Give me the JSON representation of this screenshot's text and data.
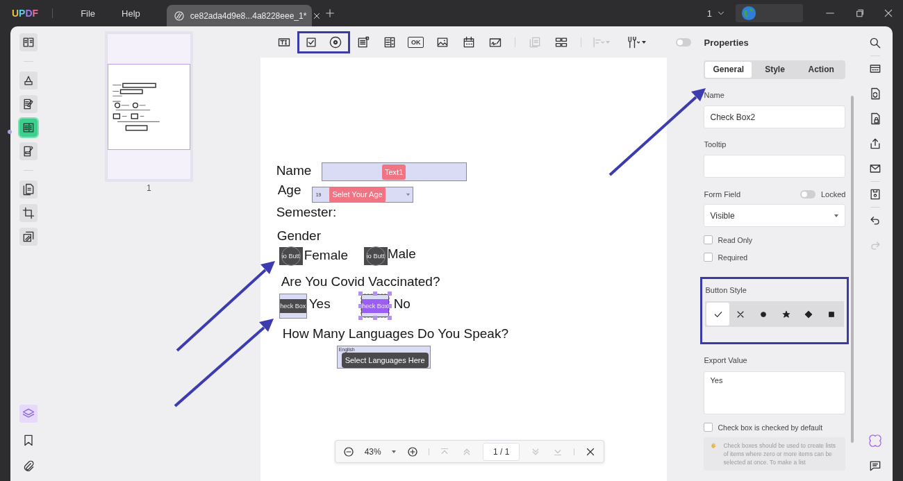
{
  "app": {
    "logo": "UPDF",
    "menus": [
      {
        "label": "File"
      },
      {
        "label": "Help"
      }
    ],
    "tab": {
      "title": "ce82ada4d9e8...4a8228eee_1*"
    },
    "page_selector": "1"
  },
  "left_tools": [
    {
      "kind": "reader",
      "selected": false
    },
    {
      "kind": "comment",
      "selected": false
    },
    {
      "kind": "edit",
      "selected": false
    },
    {
      "kind": "form",
      "selected": true
    },
    {
      "kind": "sign",
      "selected": false
    },
    {
      "kind": "organize",
      "selected": false
    },
    {
      "kind": "crop",
      "selected": false
    },
    {
      "kind": "layers-page",
      "selected": false
    }
  ],
  "left_bottom": [
    {
      "kind": "layers",
      "selected": true
    },
    {
      "kind": "bookmark",
      "selected": false
    },
    {
      "kind": "attachment",
      "selected": false
    }
  ],
  "thumbnail": {
    "page_number": "1",
    "selected": true
  },
  "toolbar": [
    {
      "kind": "text-field",
      "highlighted": false,
      "disabled": false
    },
    {
      "kind": "checkbox",
      "highlighted": true,
      "disabled": false
    },
    {
      "kind": "radio",
      "highlighted": true,
      "disabled": false
    },
    {
      "kind": "dropdown",
      "highlighted": false,
      "disabled": false
    },
    {
      "kind": "listbox",
      "highlighted": false,
      "disabled": false
    },
    {
      "kind": "button",
      "label": "OK",
      "highlighted": false,
      "disabled": false
    },
    {
      "kind": "image",
      "highlighted": false,
      "disabled": false
    },
    {
      "kind": "date",
      "highlighted": false,
      "disabled": false
    },
    {
      "kind": "signature",
      "highlighted": false,
      "disabled": false
    },
    {
      "kind": "duplicate",
      "highlighted": false,
      "disabled": true
    },
    {
      "kind": "grid",
      "highlighted": false,
      "disabled": false
    },
    {
      "kind": "align",
      "highlighted": false,
      "disabled": true
    },
    {
      "kind": "tools-menu",
      "highlighted": false,
      "disabled": false
    }
  ],
  "toolbar_toggle": {
    "on": false
  },
  "document": {
    "items": [
      {
        "kind": "label",
        "text": "Name"
      },
      {
        "kind": "text-field",
        "tag": "Text1"
      },
      {
        "kind": "label",
        "text": "Age"
      },
      {
        "kind": "combo",
        "value": "19",
        "tag": "Selet Your Age"
      },
      {
        "kind": "label",
        "text": "Semester:"
      },
      {
        "kind": "label",
        "text": "Gender"
      },
      {
        "kind": "radio",
        "caption": "io Butt"
      },
      {
        "kind": "label",
        "text": "Female"
      },
      {
        "kind": "radio",
        "caption": "io Butt"
      },
      {
        "kind": "label",
        "text": "Male"
      },
      {
        "kind": "label",
        "text": "Are You Covid Vaccinated?"
      },
      {
        "kind": "checkbox",
        "caption": "heck Box",
        "selected": false
      },
      {
        "kind": "label",
        "text": "Yes"
      },
      {
        "kind": "checkbox",
        "caption": "heck Box",
        "selected": true
      },
      {
        "kind": "label",
        "text": "No"
      },
      {
        "kind": "label",
        "text": "How Many Languages Do You Speak?"
      },
      {
        "kind": "listbox",
        "items": [
          "English"
        ],
        "tooltip": "Select Languages Here"
      }
    ]
  },
  "zoom_bar": {
    "zoom": "43%",
    "page": "1 / 1",
    "nav": [
      {
        "kind": "first",
        "disabled": true
      },
      {
        "kind": "prev",
        "disabled": true
      },
      {
        "kind": "next",
        "disabled": true
      },
      {
        "kind": "last",
        "disabled": true
      }
    ]
  },
  "properties": {
    "title": "Properties",
    "tabs": [
      {
        "label": "General",
        "selected": true
      },
      {
        "label": "Style",
        "selected": false
      },
      {
        "label": "Action",
        "selected": false
      }
    ],
    "name_label": "Name",
    "name_value": "Check Box2",
    "tooltip_label": "Tooltip",
    "form_field_label": "Form Field",
    "locked": {
      "label": "Locked",
      "on": false
    },
    "visibility": "Visible",
    "options": [
      {
        "label": "Read Only",
        "checked": false
      },
      {
        "label": "Required",
        "checked": false
      }
    ],
    "button_style": {
      "label": "Button Style",
      "highlighted": true,
      "styles": [
        {
          "kind": "check",
          "selected": true
        },
        {
          "kind": "cross",
          "selected": false
        },
        {
          "kind": "circle",
          "selected": false
        },
        {
          "kind": "star",
          "selected": false
        },
        {
          "kind": "diamond",
          "selected": false
        },
        {
          "kind": "square",
          "selected": false
        }
      ]
    },
    "export_label": "Export Value",
    "export_value": "Yes",
    "default_checked": {
      "label": "Check box is checked by default",
      "checked": false
    },
    "note": "Check boxes should be used to create lists of items where zero or more items can be selected at once. To make a list"
  },
  "right_tools": [
    {
      "kind": "search",
      "disabled": false
    },
    {
      "kind": "ocr",
      "disabled": false
    },
    {
      "kind": "convert",
      "disabled": false
    },
    {
      "kind": "protect",
      "disabled": false
    },
    {
      "kind": "share",
      "disabled": false
    },
    {
      "kind": "mail",
      "disabled": false
    },
    {
      "kind": "save",
      "disabled": false
    },
    {
      "kind": "undo",
      "disabled": false
    },
    {
      "kind": "redo",
      "disabled": true
    }
  ],
  "right_bottom": [
    {
      "kind": "app-logo"
    },
    {
      "kind": "comment-box"
    }
  ]
}
